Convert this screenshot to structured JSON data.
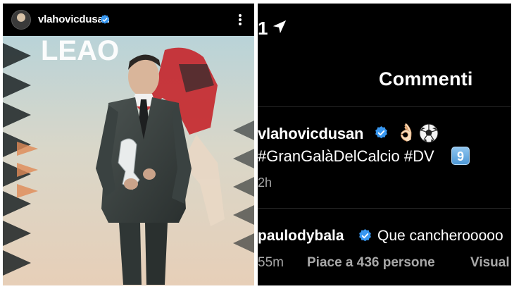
{
  "post": {
    "username": "vlahovicdusan",
    "image_text": "LEAO",
    "icons": {
      "avatar": "profile-avatar",
      "verified": "verified-badge-icon",
      "more": "more-options-icon"
    }
  },
  "status_bar": {
    "time_fragment": "1",
    "icon": "location-arrow-icon"
  },
  "comments_screen": {
    "title": "Commenti",
    "caption": {
      "username": "vlahovicdusan",
      "emoji_ok": "👌🏻",
      "emoji_ball": "soccer-ball-icon",
      "hashtags": "#GranGalàDelCalcio #DV",
      "number_badge": "9",
      "time": "2h"
    },
    "comment": {
      "username": "paulodybala",
      "text": "Que cancherooooo",
      "time": "55m",
      "likes": "Piace a 436 persone",
      "reply_fragment": "Visual"
    }
  },
  "colors": {
    "background": "#000000",
    "verified": "#3897f0",
    "secondary_text": "#a8a8a8",
    "badge": "#5ea6dd"
  }
}
